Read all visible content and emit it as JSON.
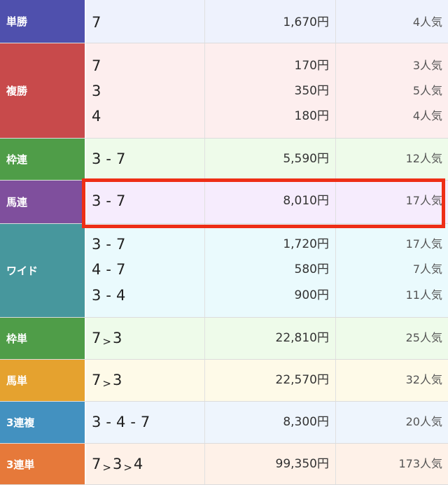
{
  "rows": [
    {
      "label": "単勝",
      "label_color": "#4f50ad",
      "bg": "#eef2fd",
      "lines": [
        {
          "combo": [
            "7"
          ],
          "payout": "1,670円",
          "popularity": "4人気"
        }
      ]
    },
    {
      "label": "複勝",
      "label_color": "#c84a4b",
      "bg": "#fdeeee",
      "lines": [
        {
          "combo": [
            "7"
          ],
          "payout": "170円",
          "popularity": "3人気"
        },
        {
          "combo": [
            "3"
          ],
          "payout": "350円",
          "popularity": "5人気"
        },
        {
          "combo": [
            "4"
          ],
          "payout": "180円",
          "popularity": "4人気"
        }
      ]
    },
    {
      "label": "枠連",
      "label_color": "#4f9d48",
      "bg": "#eefbea",
      "lines": [
        {
          "combo": [
            "3",
            "-",
            "7"
          ],
          "payout": "5,590円",
          "popularity": "12人気"
        }
      ]
    },
    {
      "label": "馬連",
      "label_color": "#7f4f9d",
      "bg": "#f6ecfd",
      "lines": [
        {
          "combo": [
            "3",
            "-",
            "7"
          ],
          "payout": "8,010円",
          "popularity": "17人気"
        }
      ]
    },
    {
      "label": "ワイド",
      "label_color": "#47979d",
      "bg": "#eafafd",
      "lines": [
        {
          "combo": [
            "3",
            "-",
            "7"
          ],
          "payout": "1,720円",
          "popularity": "17人気"
        },
        {
          "combo": [
            "4",
            "-",
            "7"
          ],
          "payout": "580円",
          "popularity": "7人気"
        },
        {
          "combo": [
            "3",
            "-",
            "4"
          ],
          "payout": "900円",
          "popularity": "11人気"
        }
      ]
    },
    {
      "label": "枠単",
      "label_color": "#4f9d48",
      "bg": "#eefbea",
      "lines": [
        {
          "combo": [
            "7",
            ">",
            "3"
          ],
          "payout": "22,810円",
          "popularity": "25人気"
        }
      ]
    },
    {
      "label": "馬単",
      "label_color": "#e5a22f",
      "bg": "#fefae8",
      "lines": [
        {
          "combo": [
            "7",
            ">",
            "3"
          ],
          "payout": "22,570円",
          "popularity": "32人気"
        }
      ]
    },
    {
      "label": "3連複",
      "label_color": "#4391c0",
      "bg": "#eef5fd",
      "lines": [
        {
          "combo": [
            "3",
            "-",
            "4",
            "-",
            "7"
          ],
          "payout": "8,300円",
          "popularity": "20人気"
        }
      ]
    },
    {
      "label": "3連単",
      "label_color": "#e6793a",
      "bg": "#fef1e8",
      "lines": [
        {
          "combo": [
            "7",
            ">",
            "3",
            ">",
            "4"
          ],
          "payout": "99,350円",
          "popularity": "173人気"
        }
      ]
    }
  ],
  "highlight_color": "#ee2e16"
}
